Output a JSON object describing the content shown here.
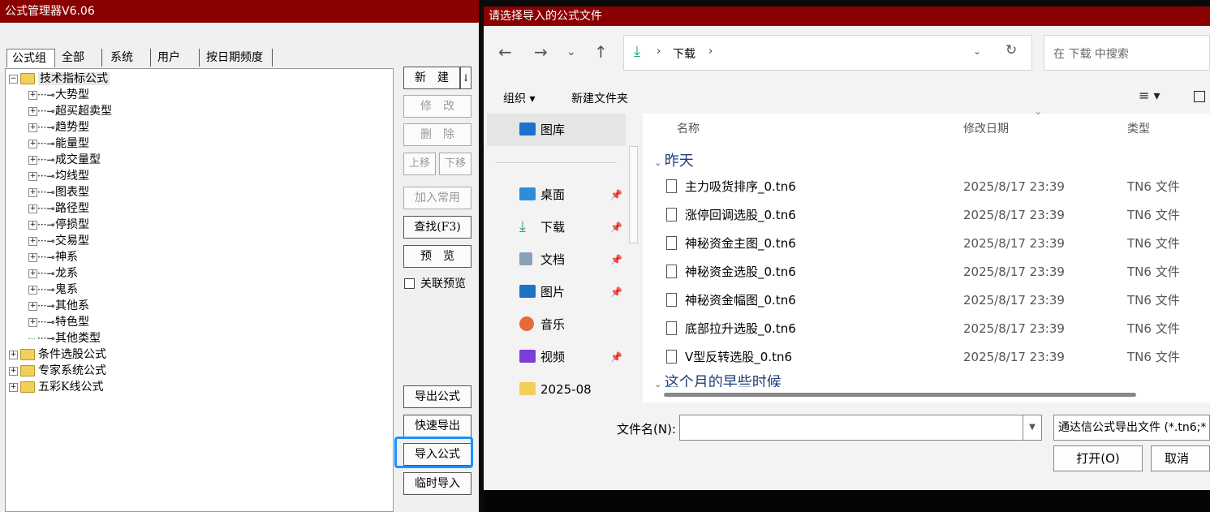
{
  "formula_manager": {
    "title": "公式管理器V6.06",
    "tabs": [
      "公式组",
      "全部",
      "系统",
      "用户",
      "按日期频度"
    ],
    "tree": {
      "root": "技术指标公式",
      "children": [
        "大势型",
        "超买超卖型",
        "趋势型",
        "能量型",
        "成交量型",
        "均线型",
        "图表型",
        "路径型",
        "停损型",
        "交易型",
        "神系",
        "龙系",
        "鬼系",
        "其他系",
        "特色型",
        "其他类型"
      ],
      "other_roots": [
        "条件选股公式",
        "专家系统公式",
        "五彩K线公式"
      ]
    },
    "buttons": {
      "new": "新　建",
      "new_arrow": "↓",
      "edit": "修　改",
      "delete": "删　除",
      "move_up": "上移",
      "move_down": "下移",
      "add_common": "加入常用",
      "find": "查找(F3)",
      "preview": "预　览",
      "export": "导出公式",
      "quick_export": "快速导出",
      "import": "导入公式",
      "temp_import": "临时导入"
    },
    "related_preview": "关联预览"
  },
  "file_dialog": {
    "title": "请选择导入的公式文件",
    "breadcrumb": "下载",
    "search_placeholder": "在 下载 中搜索",
    "toolbar": {
      "organize": "组织 ▾",
      "new_folder": "新建文件夹"
    },
    "sidebar": [
      "图库",
      "桌面",
      "下载",
      "文档",
      "图片",
      "音乐",
      "视频",
      "2025-08"
    ],
    "columns": {
      "name": "名称",
      "date": "修改日期",
      "type": "类型"
    },
    "group_yesterday": "昨天",
    "group_earlier": "这个月的早些时候",
    "files": [
      {
        "name": "主力吸货排序_0.tn6",
        "date": "2025/8/17 23:39",
        "type": "TN6 文件"
      },
      {
        "name": "涨停回调选股_0.tn6",
        "date": "2025/8/17 23:39",
        "type": "TN6 文件"
      },
      {
        "name": "神秘资金主图_0.tn6",
        "date": "2025/8/17 23:39",
        "type": "TN6 文件"
      },
      {
        "name": "神秘资金选股_0.tn6",
        "date": "2025/8/17 23:39",
        "type": "TN6 文件"
      },
      {
        "name": "神秘资金幅图_0.tn6",
        "date": "2025/8/17 23:39",
        "type": "TN6 文件"
      },
      {
        "name": "底部拉升选股_0.tn6",
        "date": "2025/8/17 23:39",
        "type": "TN6 文件"
      },
      {
        "name": "V型反转选股_0.tn6",
        "date": "2025/8/17 23:39",
        "type": "TN6 文件"
      }
    ],
    "filename_label": "文件名(N):",
    "filename_value": "",
    "filetype": "通达信公式导出文件 (*.tn6;*",
    "open": "打开(O)",
    "cancel": "取消"
  },
  "colors": {
    "title_bar": "#8b0000",
    "highlight": "#1e90ff",
    "folder": "#f2cf58"
  }
}
